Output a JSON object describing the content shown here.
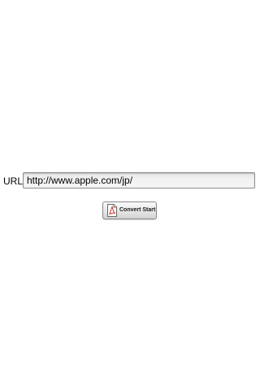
{
  "form": {
    "url_label": "URL:",
    "url_value": "http://www.apple.com/jp/"
  },
  "convert": {
    "label": "Convert Start",
    "icon": "pdf-document-icon"
  },
  "colors": {
    "background": "#ffffff",
    "input_border": "#8c8c8c",
    "button_border": "#8a8a8a",
    "pdf_icon_red": "#c0392b"
  }
}
